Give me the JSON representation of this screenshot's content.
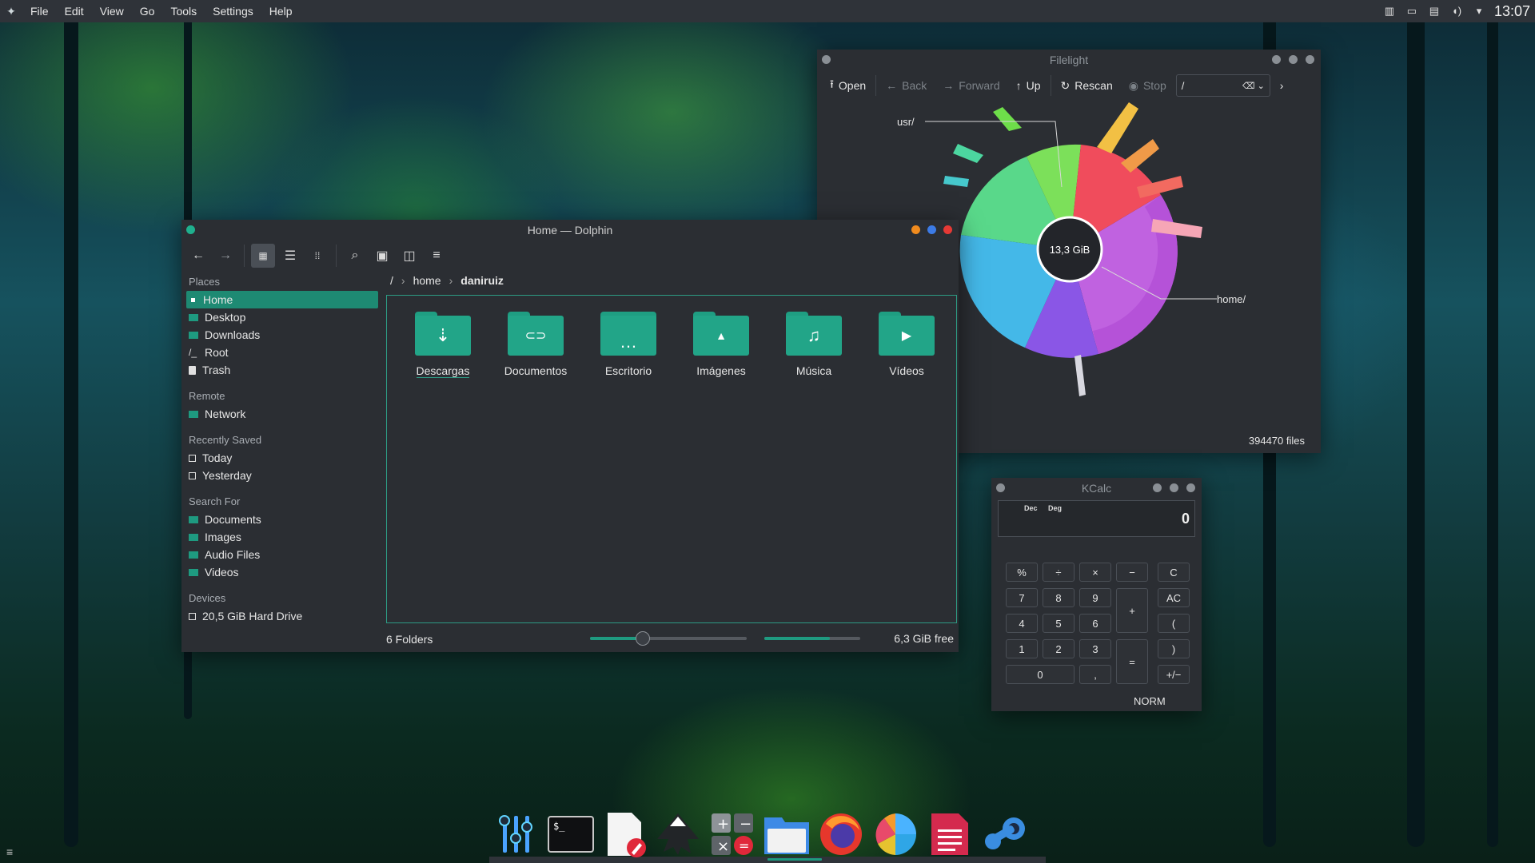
{
  "topbar": {
    "menus": [
      "File",
      "Edit",
      "View",
      "Go",
      "Tools",
      "Settings",
      "Help"
    ],
    "clock": "13:07"
  },
  "dolphin": {
    "title": "Home — Dolphin",
    "places_header": "Places",
    "places": [
      {
        "label": "Home",
        "icon": "home-icon",
        "selected": true
      },
      {
        "label": "Desktop",
        "icon": "desktop-icon"
      },
      {
        "label": "Downloads",
        "icon": "downloads-icon"
      },
      {
        "label": "Root",
        "icon": "root-icon"
      },
      {
        "label": "Trash",
        "icon": "trash-icon"
      }
    ],
    "remote_header": "Remote",
    "remote": [
      {
        "label": "Network",
        "icon": "network-icon"
      }
    ],
    "recent_header": "Recently Saved",
    "recent": [
      {
        "label": "Today",
        "icon": "calendar-icon"
      },
      {
        "label": "Yesterday",
        "icon": "calendar-icon"
      }
    ],
    "search_header": "Search For",
    "search": [
      {
        "label": "Documents",
        "icon": "documents-icon"
      },
      {
        "label": "Images",
        "icon": "images-icon"
      },
      {
        "label": "Audio Files",
        "icon": "audio-icon"
      },
      {
        "label": "Videos",
        "icon": "videos-icon"
      }
    ],
    "devices_header": "Devices",
    "devices": [
      {
        "label": "20,5 GiB Hard Drive",
        "icon": "harddrive-icon"
      }
    ],
    "breadcrumb": [
      "/",
      "home",
      "daniruiz"
    ],
    "folders": [
      {
        "label": "Descargas",
        "glyph": "⇣",
        "icon": "download-folder-icon"
      },
      {
        "label": "Documentos",
        "glyph": "⊂⊃",
        "icon": "documents-folder-icon"
      },
      {
        "label": "Escritorio",
        "glyph": "…",
        "icon": "desktop-folder-icon"
      },
      {
        "label": "Imágenes",
        "glyph": "▲",
        "icon": "pictures-folder-icon"
      },
      {
        "label": "Música",
        "glyph": "♫",
        "icon": "music-folder-icon"
      },
      {
        "label": "Vídeos",
        "glyph": "▶",
        "icon": "videos-folder-icon"
      }
    ],
    "status_count": "6 Folders",
    "zoom_fraction": 0.33,
    "disk_used_fraction": 0.68,
    "free_space": "6,3 GiB free"
  },
  "filelight": {
    "title": "Filelight",
    "toolbar": {
      "open": "Open",
      "back": "Back",
      "forward": "Forward",
      "up": "Up",
      "rescan": "Rescan",
      "stop": "Stop",
      "path": "/"
    },
    "center_label": "13,3 GiB",
    "label_usr": "usr/",
    "label_home": "home/",
    "files": "394470 files"
  },
  "kcalc": {
    "title": "KCalc",
    "mode_dec": "Dec",
    "mode_deg": "Deg",
    "display": "0",
    "keys": [
      "%",
      "÷",
      "×",
      "−",
      "C",
      "7",
      "8",
      "9",
      "+",
      "AC",
      "4",
      "5",
      "6",
      "(",
      "1",
      "2",
      "3",
      "=",
      ")",
      "0",
      ",",
      "+/−"
    ],
    "status": "NORM"
  },
  "dock": {
    "apps": [
      "mixer-icon",
      "terminal-icon",
      "text-editor-icon",
      "inkscape-icon",
      "calculator-icon",
      "file-manager-icon",
      "firefox-icon",
      "filelight-icon",
      "document-viewer-icon",
      "steam-icon"
    ]
  },
  "colors": {
    "accent": "#1e9a80",
    "window": "#2b2e33",
    "panel": "#2f3339"
  }
}
